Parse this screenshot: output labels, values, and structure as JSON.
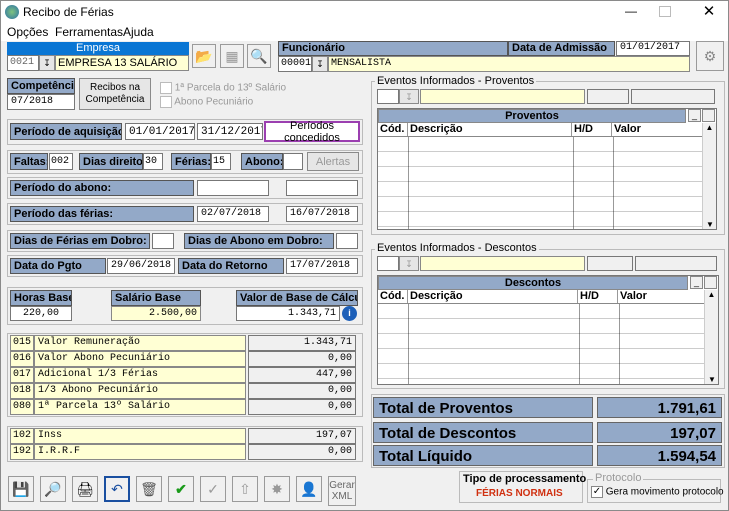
{
  "window": {
    "title": "Recibo de Férias"
  },
  "menu": [
    "Opções",
    "Ferramentas",
    "Ajuda"
  ],
  "empresa": {
    "header": "Empresa",
    "code": "0021",
    "name": "EMPRESA 13 SALÁRIO"
  },
  "funcionario": {
    "header": "Funcionário",
    "code": "00001",
    "name": "MENSALISTA",
    "admissao_label": "Data de Admissão",
    "admissao": "01/01/2017"
  },
  "competencia": {
    "label": "Competência",
    "value": "07/2018",
    "recibos_btn": "Recibos na Competência",
    "parcela13": "1ª Parcela do 13º Salário",
    "abono": "Abono Pecuniário"
  },
  "aquisicao": {
    "label": "Período de aquisição:",
    "start": "01/01/2017",
    "end": "31/12/2017",
    "btn": "Períodos concedidos"
  },
  "faltas": {
    "label": "Faltas:",
    "value": "002",
    "direito_label": "Dias direito:",
    "direito": "30",
    "ferias_label": "Férias:",
    "ferias": "15",
    "abono_label": "Abono:",
    "alertas": "Alertas"
  },
  "periodo_abono": {
    "label": "Período do abono:"
  },
  "periodo_ferias": {
    "label": "Período das férias:",
    "start": "02/07/2018",
    "end": "16/07/2018"
  },
  "dobro": {
    "ferias_label": "Dias de Férias em Dobro:",
    "abono_label": "Dias de Abono em Dobro:"
  },
  "pgto": {
    "label": "Data do Pgto",
    "value": "29/06/2018",
    "retorno_label": "Data do Retorno",
    "retorno": "17/07/2018"
  },
  "bases": {
    "horas_label": "Horas Base",
    "horas": "220,00",
    "salario_label": "Salário Base",
    "salario": "2.500,00",
    "calculo_label": "Valor de Base de Cálculo",
    "calculo": "1.343,71"
  },
  "eventos": [
    {
      "code": "015",
      "desc": "Valor Remuneração",
      "value": "1.343,71"
    },
    {
      "code": "016",
      "desc": "Valor Abono Pecuniário",
      "value": "0,00"
    },
    {
      "code": "017",
      "desc": "Adicional 1/3 Férias",
      "value": "447,90"
    },
    {
      "code": "018",
      "desc": "1/3 Abono Pecuniário",
      "value": "0,00"
    },
    {
      "code": "080",
      "desc": "1ª Parcela 13º Salário",
      "value": "0,00"
    }
  ],
  "descontos_list": [
    {
      "code": "102",
      "desc": "Inss",
      "value": "197,07"
    },
    {
      "code": "192",
      "desc": "I.R.R.F",
      "value": "0,00"
    }
  ],
  "proventos_panel": {
    "group": "Eventos Informados - Proventos",
    "title": "Proventos",
    "cols": [
      "Cód.",
      "Descrição",
      "H/D",
      "Valor"
    ]
  },
  "descontos_panel": {
    "group": "Eventos Informados - Descontos",
    "title": "Descontos",
    "cols": [
      "Cód.",
      "Descrição",
      "H/D",
      "Valor"
    ]
  },
  "totais": {
    "proventos_label": "Total de Proventos",
    "proventos": "1.791,61",
    "descontos_label": "Total de Descontos",
    "descontos": "197,07",
    "liquido_label": "Total Líquido",
    "liquido": "1.594,54"
  },
  "processamento": {
    "label": "Tipo de processamento",
    "value": "FÉRIAS NORMAIS"
  },
  "protocolo": {
    "group": "Protocolo",
    "checkbox": "Gera movimento protocolo"
  },
  "toolbar": {
    "gerar_xml": "Gerar XML"
  },
  "colors": {
    "label_bg": "#93a9c8",
    "yellow": "#ffffd4",
    "processing": "#d03010",
    "highlight_border": "#9b3fb0"
  }
}
